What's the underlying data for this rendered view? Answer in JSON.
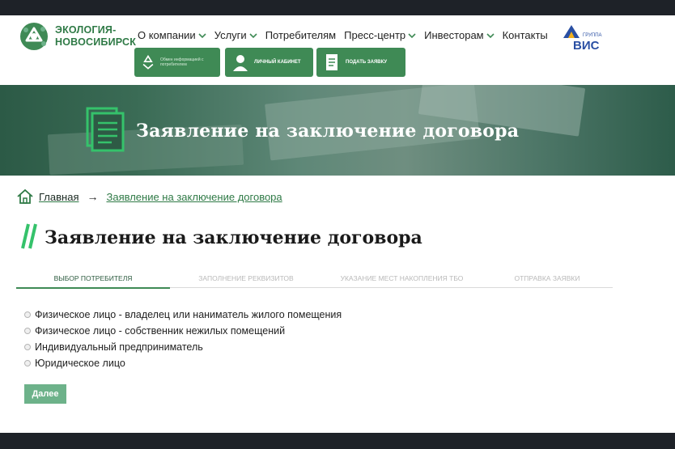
{
  "logo": {
    "line1": "ЭКОЛОГИЯ-",
    "line2": "НОВОСИБИРСК",
    "icon": "recycle-tree-icon"
  },
  "nav": [
    {
      "label": "О компании",
      "dropdown": true
    },
    {
      "label": "Услуги",
      "dropdown": true
    },
    {
      "label": "Потребителям",
      "dropdown": false
    },
    {
      "label": "Пресс-центр",
      "dropdown": true
    },
    {
      "label": "Инвесторам",
      "dropdown": true
    },
    {
      "label": "Контакты",
      "dropdown": false
    }
  ],
  "partner": {
    "small": "ГРУППА",
    "big": "ВИС"
  },
  "quick_links": [
    {
      "title": "",
      "subtitle": "Обмен информацией с потребителем",
      "icon": "recycle-icon"
    },
    {
      "title": "Личный кабинет",
      "subtitle": "",
      "icon": "user-icon"
    },
    {
      "title": "Подать заявку",
      "subtitle": "",
      "icon": "document-icon"
    }
  ],
  "banner": {
    "title": "Заявление на заключение договора",
    "icon": "document-icon"
  },
  "breadcrumb": {
    "home": "Главная",
    "arrow": "→",
    "current": "Заявление на заключение договора"
  },
  "page_title": "Заявление на заключение договора",
  "steps": [
    {
      "label": "Выбор потребителя",
      "active": true
    },
    {
      "label": "Заполнение реквизитов",
      "active": false
    },
    {
      "label": "Указание мест накопления ТБО",
      "active": false
    },
    {
      "label": "Отправка заявки",
      "active": false
    }
  ],
  "options": [
    "Физическое лицо - владелец или наниматель жилого помещения",
    "Физическое лицо - собственник нежилых помещений",
    "Индивидуальный предприниматель",
    "Юридическое лицо"
  ],
  "next_button": "Далее",
  "colors": {
    "brand_green": "#3f8a55",
    "button_green": "#6db28a",
    "dark_frame": "#1e2228"
  }
}
